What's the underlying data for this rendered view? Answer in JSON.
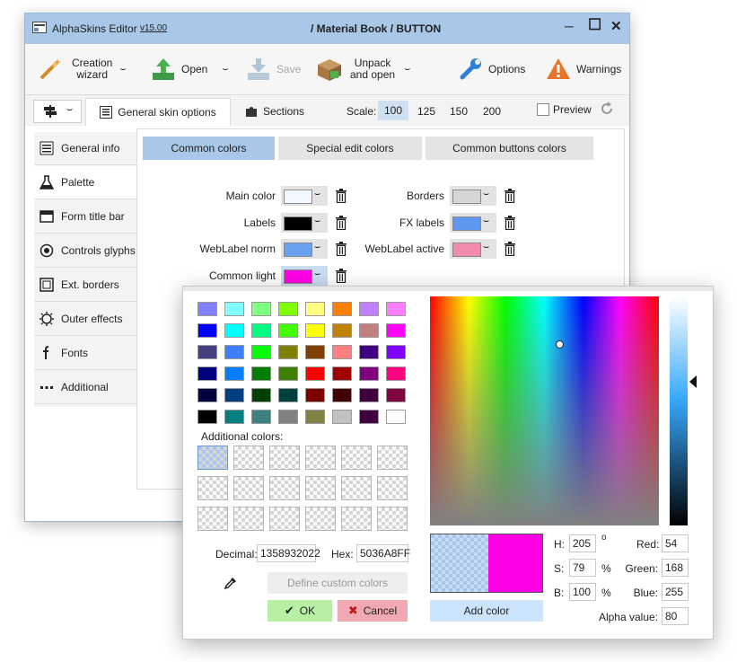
{
  "app": {
    "title": "AlphaSkins Editor",
    "version": "v15.00",
    "document_title": "/ Material Book / BUTTON",
    "controls": {
      "minimize": "─",
      "maximize": "☐",
      "close": "✕"
    }
  },
  "toolbar": {
    "creation_wizard": "Creation\nwizard",
    "open": "Open",
    "save": "Save",
    "unpack_open": "Unpack\nand open",
    "options": "Options",
    "warnings": "Warnings",
    "dropdown_glyph": "⌣"
  },
  "tabs": {
    "general_skin_options": "General skin options",
    "sections": "Sections",
    "scale_label": "Scale:",
    "scale_values": [
      "100",
      "125",
      "150",
      "200"
    ],
    "scale_selected": "100",
    "preview_label": "Preview"
  },
  "nav": {
    "items": [
      {
        "label": "General info",
        "icon": "info-icon"
      },
      {
        "label": "Palette",
        "icon": "flask-icon",
        "active": true
      },
      {
        "label": "Form title bar",
        "icon": "titlebar-icon"
      },
      {
        "label": "Controls glyphs",
        "icon": "radio-glyph-icon"
      },
      {
        "label": "Ext. borders",
        "icon": "borders-icon"
      },
      {
        "label": "Outer effects",
        "icon": "sun-icon"
      },
      {
        "label": "Fonts",
        "icon": "font-icon"
      },
      {
        "label": "Additional",
        "icon": "dots-icon"
      }
    ]
  },
  "palette": {
    "subtabs": [
      "Common colors",
      "Special edit colors",
      "Common buttons colors"
    ],
    "subtab_selected": "Common colors",
    "left_colors": [
      {
        "label": "Main color",
        "color": "#f2f8ff"
      },
      {
        "label": "Labels",
        "color": "#000000"
      },
      {
        "label": "WebLabel norm",
        "color": "#6aa0f0"
      },
      {
        "label": "Common light",
        "color": "#ff00e6"
      }
    ],
    "right_colors": [
      {
        "label": "Borders",
        "color": "#d6d6d6"
      },
      {
        "label": "FX labels",
        "color": "#5e97f0"
      },
      {
        "label": "WebLabel active",
        "color": "#f28aaf"
      }
    ]
  },
  "color_dialog": {
    "basic_colors": [
      [
        "#8080ff",
        "#80ffff",
        "#80ff80",
        "#80ff00",
        "#ffff80",
        "#ff8000",
        "#c080ff",
        "#ff80ff"
      ],
      [
        "#0000ff",
        "#00ffff",
        "#00ff80",
        "#40ff00",
        "#ffff00",
        "#c08000",
        "#c08080",
        "#ff00ff"
      ],
      [
        "#404080",
        "#4080ff",
        "#00ff00",
        "#808000",
        "#804000",
        "#ff8080",
        "#400080",
        "#8000ff"
      ],
      [
        "#000080",
        "#0080ff",
        "#008000",
        "#408000",
        "#ff0000",
        "#a00000",
        "#800080",
        "#ff0080"
      ],
      [
        "#000040",
        "#004080",
        "#004000",
        "#004040",
        "#800000",
        "#400000",
        "#400040",
        "#800040"
      ],
      [
        "#000000",
        "#008080",
        "#408080",
        "#808080",
        "#808040",
        "#c0c0c0",
        "#400040",
        "#ffffff"
      ]
    ],
    "additional_colors_label": "Additional colors:",
    "decimal_label": "Decimal:",
    "decimal_value": "1358932022",
    "hex_label": "Hex:",
    "hex_value": "5036A8FF",
    "define_custom": "Define custom colors",
    "ok": "OK",
    "cancel": "Cancel",
    "ok_icon": "✔",
    "cancel_icon": "✖",
    "add_color": "Add color",
    "old_color": "#a8c6ec",
    "new_color": "#ff00e6",
    "h_label": "H:",
    "h_value": "205",
    "h_unit": "o",
    "s_label": "S:",
    "s_value": "79",
    "s_unit": "%",
    "b_label": "B:",
    "b_value": "100",
    "b_unit": "%",
    "red_label": "Red:",
    "red_value": "54",
    "green_label": "Green:",
    "green_value": "168",
    "blue_label": "Blue:",
    "blue_value": "255",
    "alpha_label": "Alpha value:",
    "alpha_value": "80"
  }
}
